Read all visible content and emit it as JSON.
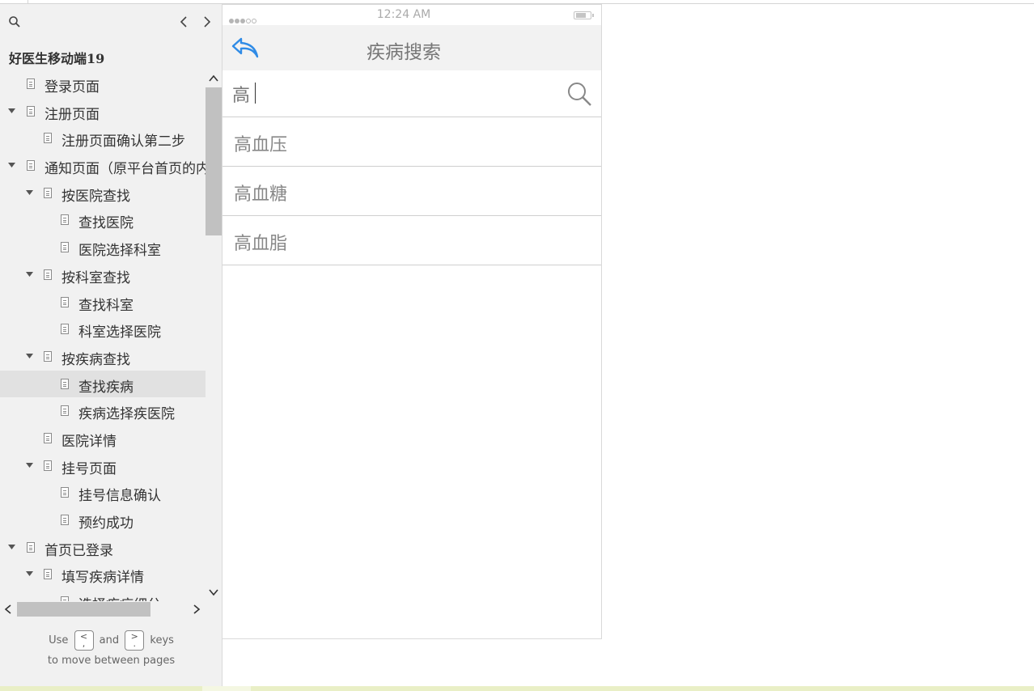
{
  "sidebar": {
    "project_title": "好医生移动端19",
    "tree": [
      {
        "label": "登录页面",
        "level": 0,
        "expandable": false,
        "active": false
      },
      {
        "label": "注册页面",
        "level": 0,
        "expandable": true,
        "active": false
      },
      {
        "label": "注册页面确认第二步",
        "level": 1,
        "expandable": false,
        "active": false
      },
      {
        "label": "通知页面（原平台首页的内",
        "level": 0,
        "expandable": true,
        "active": false
      },
      {
        "label": "按医院查找",
        "level": 1,
        "expandable": true,
        "active": false
      },
      {
        "label": "查找医院",
        "level": 2,
        "expandable": false,
        "active": false
      },
      {
        "label": "医院选择科室",
        "level": 2,
        "expandable": false,
        "active": false
      },
      {
        "label": "按科室查找",
        "level": 1,
        "expandable": true,
        "active": false
      },
      {
        "label": "查找科室",
        "level": 2,
        "expandable": false,
        "active": false
      },
      {
        "label": "科室选择医院",
        "level": 2,
        "expandable": false,
        "active": false
      },
      {
        "label": "按疾病查找",
        "level": 1,
        "expandable": true,
        "active": false
      },
      {
        "label": "查找疾病",
        "level": 2,
        "expandable": false,
        "active": true
      },
      {
        "label": "疾病选择疾医院",
        "level": 2,
        "expandable": false,
        "active": false
      },
      {
        "label": "医院详情",
        "level": 1,
        "expandable": false,
        "active": false
      },
      {
        "label": "挂号页面",
        "level": 1,
        "expandable": true,
        "active": false
      },
      {
        "label": "挂号信息确认",
        "level": 2,
        "expandable": false,
        "active": false
      },
      {
        "label": "预约成功",
        "level": 2,
        "expandable": false,
        "active": false
      },
      {
        "label": "首页已登录",
        "level": 0,
        "expandable": true,
        "active": false
      },
      {
        "label": "填写疾病详情",
        "level": 1,
        "expandable": true,
        "active": false
      },
      {
        "label": "选择疾病细分",
        "level": 2,
        "expandable": false,
        "active": false
      }
    ],
    "hint": {
      "use": "Use",
      "key_prev": "<\n,",
      "and": "and",
      "key_next": ">\n.",
      "keys": "keys",
      "line2": "to move between pages"
    }
  },
  "phone": {
    "status": {
      "time": "12:24 AM",
      "signal_bars": 3,
      "signal_total": 5
    },
    "nav": {
      "title": "疾病搜索",
      "back_icon": "back-reply-arrow-icon",
      "accent": "#2f8be6"
    },
    "search": {
      "value": "高",
      "icon": "magnifier-icon"
    },
    "results": [
      "高血压",
      "高血糖",
      "高血脂"
    ]
  },
  "colors": {
    "sidebar_bg": "#f1f1f1",
    "active_item": "#e1e1e1",
    "navbar_bg": "#f2f2f2",
    "bottom_bar": "#e9efc6"
  }
}
